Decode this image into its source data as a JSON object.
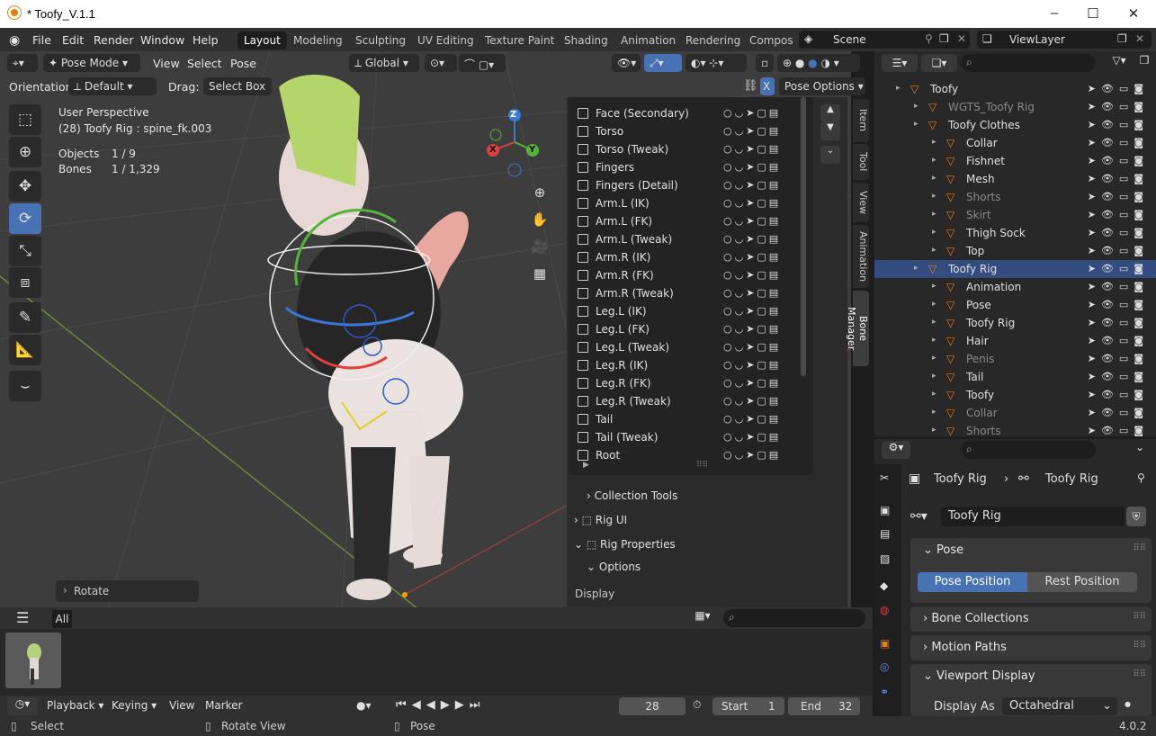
{
  "window": {
    "title": "* Toofy_V.1.1"
  },
  "menubar": {
    "items": [
      "File",
      "Edit",
      "Render",
      "Window",
      "Help"
    ],
    "workspaces": [
      "Layout",
      "Modeling",
      "Sculpting",
      "UV Editing",
      "Texture Paint",
      "Shading",
      "Animation",
      "Rendering",
      "Compos"
    ],
    "active_workspace": "Layout",
    "scene": "Scene",
    "view_layer": "ViewLayer"
  },
  "viewport_header": {
    "mode": "Pose Mode",
    "menus": [
      "View",
      "Select",
      "Pose"
    ],
    "transform_orientation": "Global",
    "orientation_label": "Orientation:",
    "orientation_value": "Default",
    "drag_label": "Drag:",
    "drag_value": "Select Box",
    "pose_options": "Pose Options",
    "x_mirror": "X"
  },
  "overlay_info": {
    "perspective": "User Perspective",
    "object_line": "(28) Toofy Rig : spine_fk.003",
    "objects_label": "Objects",
    "objects_value": "1 / 9",
    "bones_label": "Bones",
    "bones_value": "1 / 1,329"
  },
  "gizmo": {
    "x": "X",
    "y": "Y",
    "z": "Z"
  },
  "last_operator": "Rotate",
  "bone_manager": {
    "rows": [
      "Face (Secondary)",
      "Torso",
      "Torso (Tweak)",
      "Fingers",
      "Fingers (Detail)",
      "Arm.L (IK)",
      "Arm.L (FK)",
      "Arm.L (Tweak)",
      "Arm.R (IK)",
      "Arm.R (FK)",
      "Arm.R (Tweak)",
      "Leg.L (IK)",
      "Leg.L (FK)",
      "Leg.L (Tweak)",
      "Leg.R (IK)",
      "Leg.R (FK)",
      "Leg.R (Tweak)",
      "Tail",
      "Tail (Tweak)",
      "Root"
    ],
    "sections": {
      "collection_tools": "Collection Tools",
      "rig_ui": "Rig UI",
      "rig_properties": "Rig Properties",
      "options": "Options",
      "display": "Display"
    }
  },
  "sidebar_tabs": [
    "Item",
    "Tool",
    "View",
    "Animation",
    "Bone Manager"
  ],
  "active_sidebar_tab": "Bone Manager",
  "outliner": {
    "rows": [
      {
        "name": "Toofy",
        "indent": 1,
        "dim": false,
        "sel": false
      },
      {
        "name": "WGTS_Toofy Rig",
        "indent": 2,
        "dim": true,
        "sel": false
      },
      {
        "name": "Toofy Clothes",
        "indent": 2,
        "dim": false,
        "sel": false
      },
      {
        "name": "Collar",
        "indent": 3,
        "dim": false,
        "sel": false
      },
      {
        "name": "Fishnet",
        "indent": 3,
        "dim": false,
        "sel": false
      },
      {
        "name": "Mesh",
        "indent": 3,
        "dim": false,
        "sel": false
      },
      {
        "name": "Shorts",
        "indent": 3,
        "dim": true,
        "sel": false
      },
      {
        "name": "Skirt",
        "indent": 3,
        "dim": true,
        "sel": false
      },
      {
        "name": "Thigh Sock",
        "indent": 3,
        "dim": false,
        "sel": false
      },
      {
        "name": "Top",
        "indent": 3,
        "dim": false,
        "sel": false
      },
      {
        "name": "Toofy Rig",
        "indent": 2,
        "dim": false,
        "sel": true
      },
      {
        "name": "Animation",
        "indent": 3,
        "dim": false,
        "sel": false
      },
      {
        "name": "Pose",
        "indent": 3,
        "dim": false,
        "sel": false
      },
      {
        "name": "Toofy Rig",
        "indent": 3,
        "dim": false,
        "sel": false
      },
      {
        "name": "Hair",
        "indent": 3,
        "dim": false,
        "sel": false
      },
      {
        "name": "Penis",
        "indent": 3,
        "dim": true,
        "sel": false
      },
      {
        "name": "Tail",
        "indent": 3,
        "dim": false,
        "sel": false
      },
      {
        "name": "Toofy",
        "indent": 3,
        "dim": false,
        "sel": false
      },
      {
        "name": "Collar",
        "indent": 3,
        "dim": true,
        "sel": false
      },
      {
        "name": "Shorts",
        "indent": 3,
        "dim": true,
        "sel": false
      }
    ]
  },
  "properties": {
    "breadcrumb_object": "Toofy Rig",
    "breadcrumb_data": "Toofy Rig",
    "data_name": "Toofy Rig",
    "panels": {
      "pose": "Pose",
      "bone_collections": "Bone Collections",
      "motion_paths": "Motion Paths",
      "viewport_display": "Viewport Display"
    },
    "pose_position": "Pose Position",
    "rest_position": "Rest Position",
    "display_as_label": "Display As",
    "display_as_value": "Octahedral"
  },
  "asset_bar": {
    "filter": "All"
  },
  "timeline": {
    "menus": [
      "Playback",
      "Keying",
      "View",
      "Marker"
    ],
    "current_frame": "28",
    "start_label": "Start",
    "start_value": "1",
    "end_label": "End",
    "end_value": "32"
  },
  "statusbar": {
    "select": "Select",
    "rotate_view": "Rotate View",
    "pose": "Pose",
    "version": "4.0.2"
  },
  "colors": {
    "accent": "#4772b3",
    "selection": "#334d80",
    "background": "#3d3d3d"
  }
}
